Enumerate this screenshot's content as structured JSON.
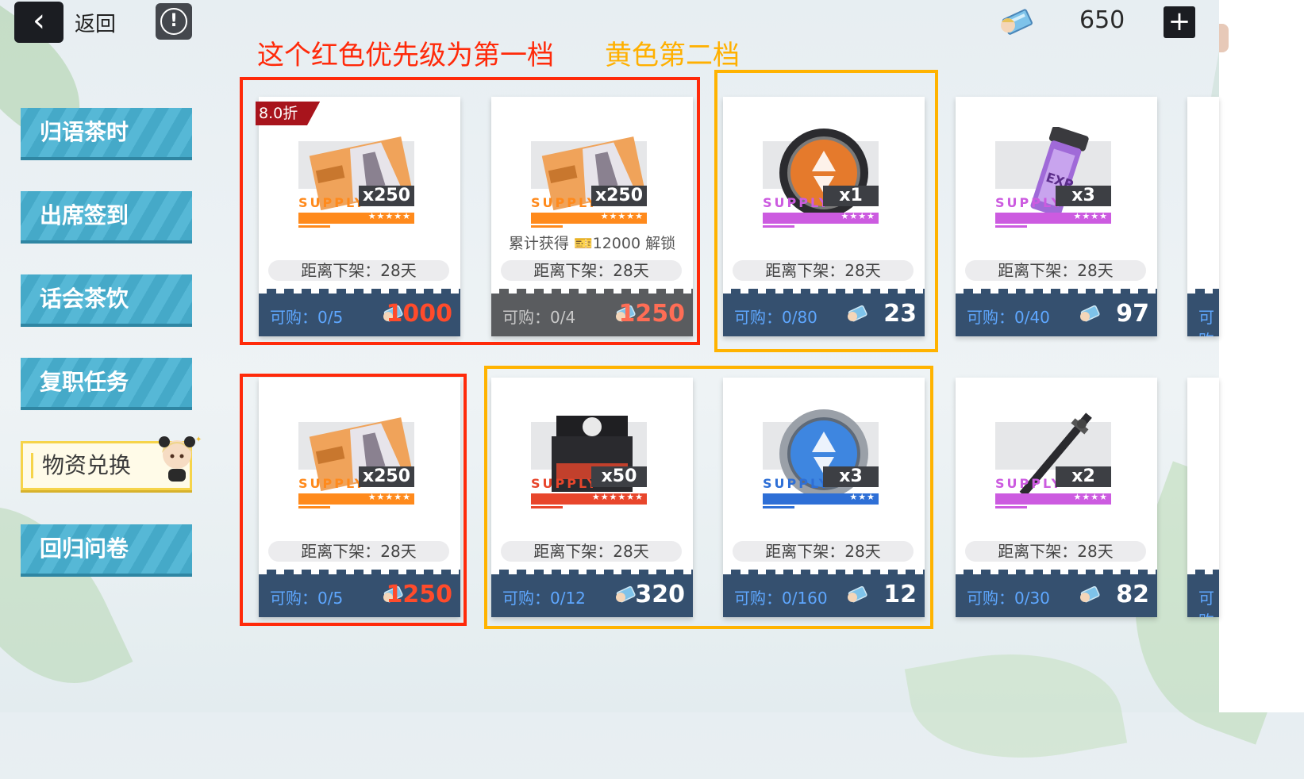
{
  "header": {
    "back_label": "返回",
    "info_symbol": "!",
    "currency_value": "650",
    "plus_symbol": "+",
    "back_symbol": "‹"
  },
  "annotations": {
    "red_note": "这个红色优先级为第一档",
    "yellow_note": "黄色第二档"
  },
  "sidebar": {
    "items": [
      {
        "label": "归语茶时"
      },
      {
        "label": "出席签到"
      },
      {
        "label": "话会茶饮"
      },
      {
        "label": "复职任务"
      },
      {
        "label": "物资兑换"
      },
      {
        "label": "回归问卷"
      }
    ]
  },
  "colors": {
    "highlight_red": "#ff2a0a",
    "highlight_yellow": "#ffb300",
    "rarity_orange": "#ff8a1c",
    "rarity_purple": "#cc5be0",
    "rarity_red": "#e8462c",
    "rarity_blue": "#2e6fd6"
  },
  "cards": [
    {
      "item_icon": "limited-ticket-icon",
      "supply": "SUPPLY",
      "qty": "x250",
      "stars": "★★★★★",
      "rarity": "orange",
      "discount": "8.0折",
      "unlock": "",
      "time": "距离下架：28天",
      "buy": "可购：0/5",
      "price": "1000",
      "price_style": "red",
      "footer": "normal"
    },
    {
      "item_icon": "limited-ticket-icon",
      "supply": "SUPPLY",
      "qty": "x250",
      "stars": "★★★★★",
      "rarity": "orange",
      "discount": "",
      "unlock": "累计获得 🎫12000 解锁",
      "time": "距离下架：28天",
      "buy": "可购：0/4",
      "price": "1250",
      "price_style": "dim",
      "footer": "gray"
    },
    {
      "item_icon": "orange-chip-icon",
      "supply": "SUPPLY",
      "qty": "x1",
      "stars": "★★★★",
      "rarity": "purple",
      "discount": "",
      "unlock": "",
      "time": "距离下架：28天",
      "buy": "可购：0/80",
      "price": "23",
      "price_style": "white",
      "footer": "normal"
    },
    {
      "item_icon": "exp-canister-icon",
      "supply": "SUPPLY",
      "qty": "x3",
      "stars": "★★★★",
      "rarity": "purple",
      "discount": "",
      "unlock": "",
      "time": "距离下架：28天",
      "buy": "可购：0/40",
      "price": "97",
      "price_style": "white",
      "footer": "normal"
    },
    {
      "item_icon": "limited-ticket-icon",
      "supply": "SUPPLY",
      "qty": "x250",
      "stars": "★★★★★",
      "rarity": "orange",
      "discount": "",
      "unlock": "",
      "time": "距离下架：28天",
      "buy": "可购：0/5",
      "price": "1250",
      "price_style": "red",
      "footer": "normal"
    },
    {
      "item_icon": "black-crate-icon",
      "supply": "SUPPLY",
      "qty": "x50",
      "stars": "★★★★★★",
      "rarity": "red",
      "discount": "",
      "unlock": "",
      "time": "距离下架：28天",
      "buy": "可购：0/12",
      "price": "320",
      "price_style": "white",
      "footer": "normal"
    },
    {
      "item_icon": "blue-chip-icon",
      "supply": "SUPPLY",
      "qty": "x3",
      "stars": "★★★",
      "rarity": "blue",
      "discount": "",
      "unlock": "",
      "time": "距离下架：28天",
      "buy": "可购：0/160",
      "price": "12",
      "price_style": "white",
      "footer": "normal"
    },
    {
      "item_icon": "black-blade-icon",
      "supply": "SUPPLY",
      "qty": "x2",
      "stars": "★★★★",
      "rarity": "purple",
      "discount": "",
      "unlock": "",
      "time": "距离下架：28天",
      "buy": "可购：0/30",
      "price": "82",
      "price_style": "white",
      "footer": "normal"
    }
  ],
  "partial_cards": [
    {
      "buy": "可购"
    },
    {
      "buy": "可购"
    }
  ]
}
